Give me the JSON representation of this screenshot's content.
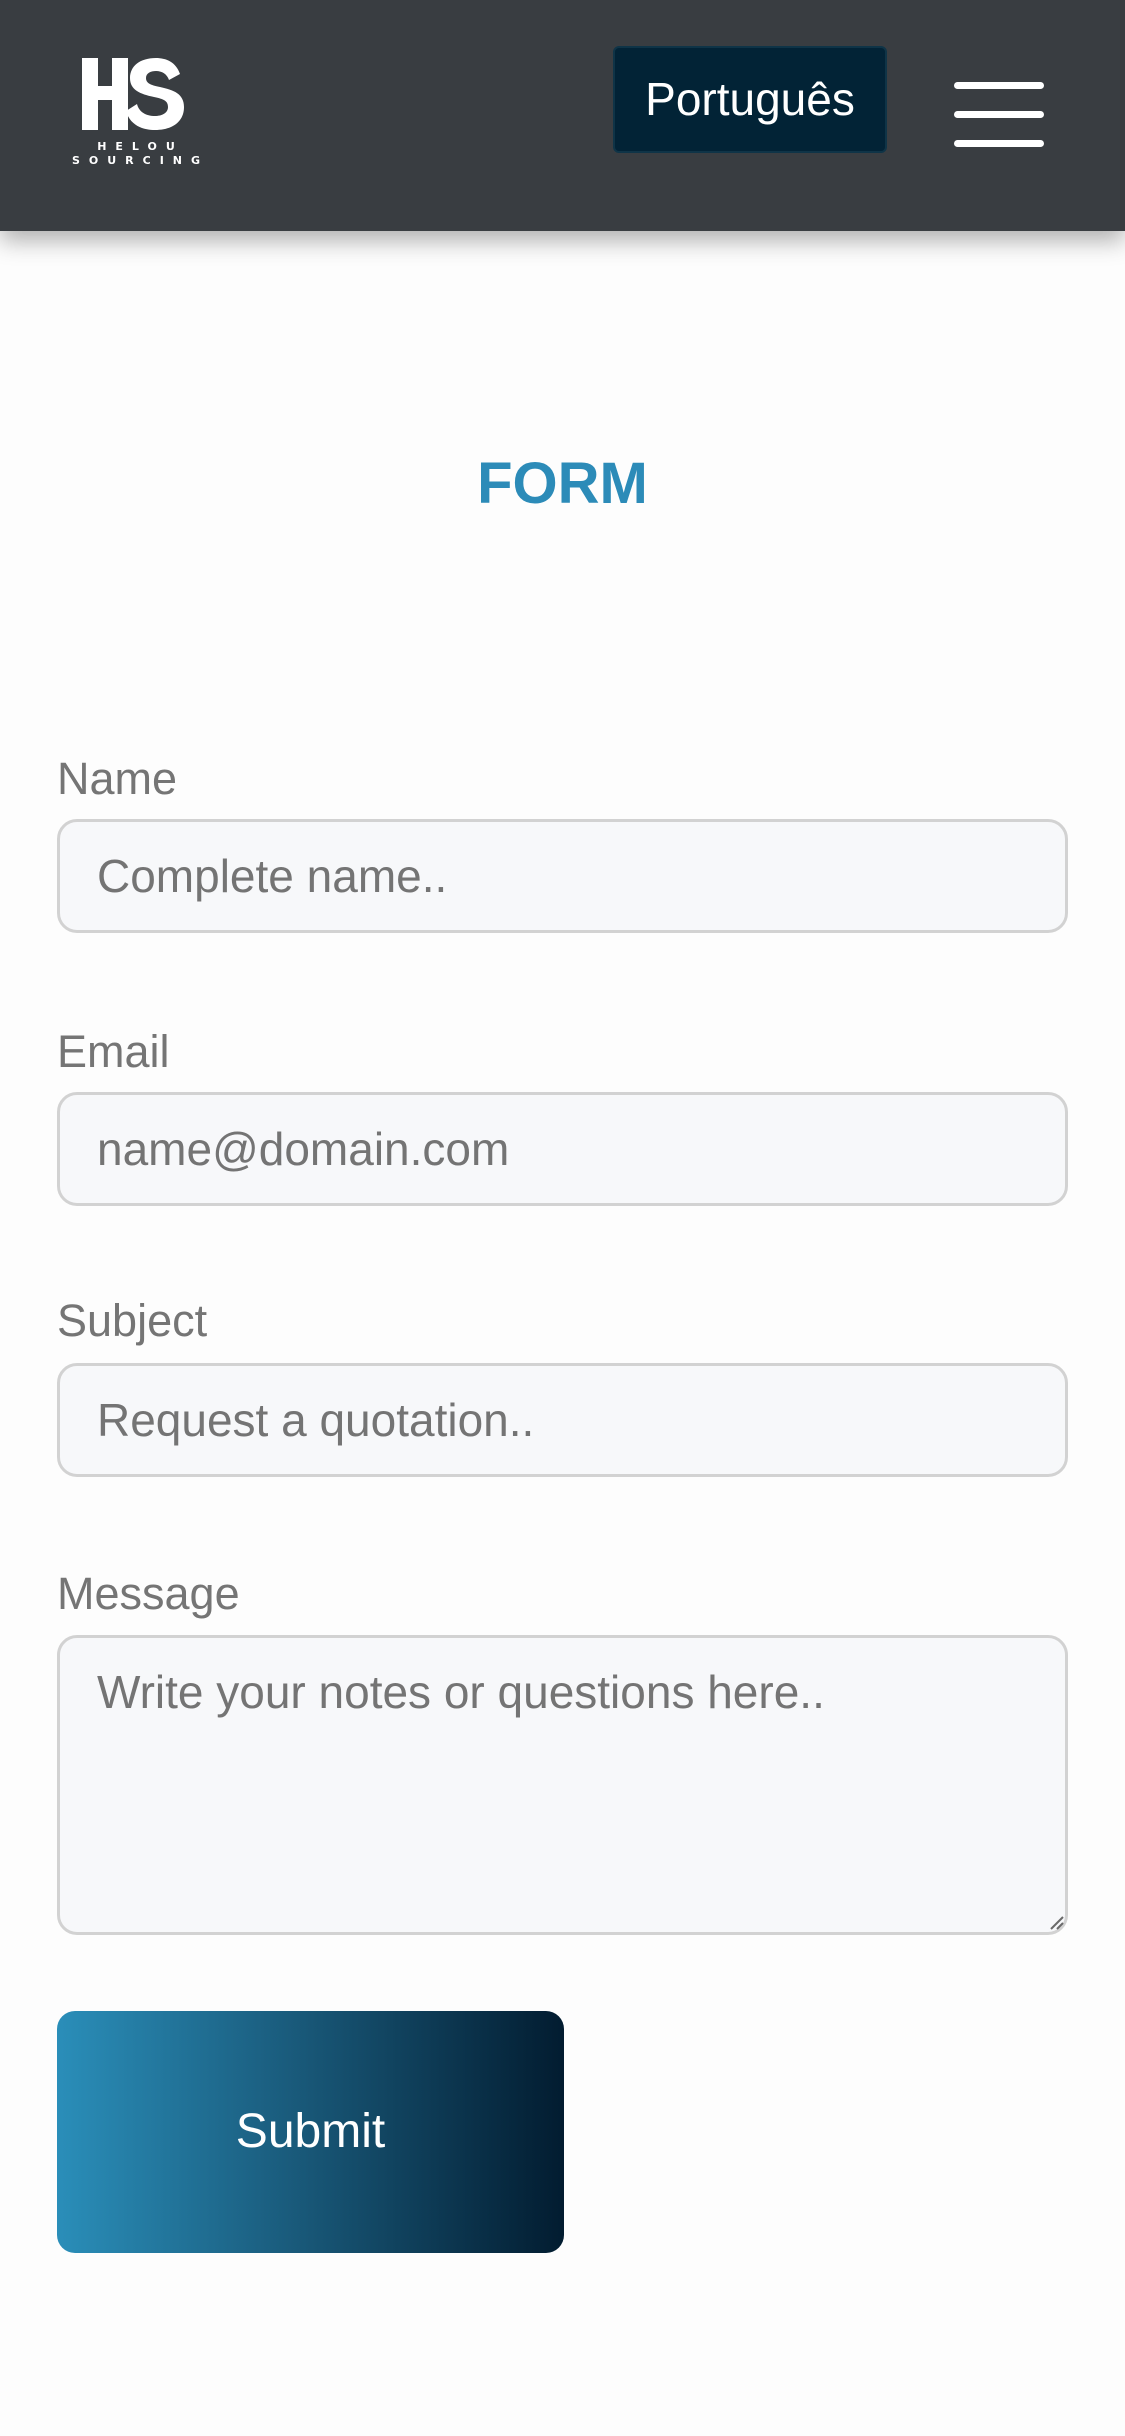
{
  "header": {
    "logo": {
      "mark": "HS",
      "line1": "HELOU",
      "line2": "SOURCING"
    },
    "language_button": "Português",
    "menu_icon": "hamburger-menu-icon",
    "background_color": "#393d41",
    "language_button_color": "#022336"
  },
  "form": {
    "title": "FORM",
    "title_color": "#2c8bb8",
    "fields": [
      {
        "label": "Name",
        "placeholder": "Complete name..",
        "value": ""
      },
      {
        "label": "Email",
        "placeholder": "name@domain.com",
        "value": ""
      },
      {
        "label": "Subject",
        "placeholder": "Request a quotation..",
        "value": ""
      },
      {
        "label": "Message",
        "placeholder": "Write your notes or questions here..",
        "value": ""
      }
    ],
    "submit_label": "Submit",
    "submit_gradient": [
      "#2a8eb9",
      "#021c30"
    ]
  }
}
